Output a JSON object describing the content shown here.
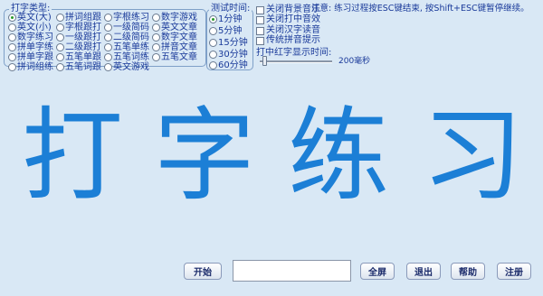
{
  "typing_type": {
    "title": "打字类型:",
    "options": [
      {
        "label": "英文(大)",
        "checked": true
      },
      {
        "label": "英文(小)",
        "checked": false
      },
      {
        "label": "数字练习",
        "checked": false
      },
      {
        "label": "拼单字练",
        "checked": false
      },
      {
        "label": "拼单字跟",
        "checked": false
      },
      {
        "label": "拼词组练",
        "checked": false
      },
      {
        "label": "拼词组跟",
        "checked": false
      },
      {
        "label": "字根跟打",
        "checked": false
      },
      {
        "label": "一级跟打",
        "checked": false
      },
      {
        "label": "二级跟打",
        "checked": false
      },
      {
        "label": "五笔单跟",
        "checked": false
      },
      {
        "label": "五笔词跟",
        "checked": false
      },
      {
        "label": "字根练习",
        "checked": false
      },
      {
        "label": "一级简码",
        "checked": false
      },
      {
        "label": "二级简码",
        "checked": false
      },
      {
        "label": "五笔单练",
        "checked": false
      },
      {
        "label": "五笔词练",
        "checked": false
      },
      {
        "label": "英文游戏",
        "checked": false
      },
      {
        "label": "数字游戏",
        "checked": false
      },
      {
        "label": "英文文章",
        "checked": false
      },
      {
        "label": "数字文章",
        "checked": false
      },
      {
        "label": "拼音文章",
        "checked": false
      },
      {
        "label": "五笔文章",
        "checked": false
      }
    ]
  },
  "test_time": {
    "title": "测试时间:",
    "options": [
      {
        "label": "1分钟",
        "checked": true
      },
      {
        "label": "5分钟",
        "checked": false
      },
      {
        "label": "15分钟",
        "checked": false
      },
      {
        "label": "30分钟",
        "checked": false
      },
      {
        "label": "60分钟",
        "checked": false
      }
    ]
  },
  "settings": [
    {
      "label": "关闭背景音乐"
    },
    {
      "label": "关闭打中音效"
    },
    {
      "label": "关闭汉字读音"
    },
    {
      "label": "传统拼音提示"
    }
  ],
  "note": "注意: 练习过程按ESC键结束, 按Shift+ESC键暂停继续。",
  "speed": {
    "label": "打中红字显示时间:",
    "value_text": "200毫秒"
  },
  "title_chars": [
    "打",
    "字",
    "练",
    "习"
  ],
  "input": {
    "value": ""
  },
  "buttons": {
    "start": "开始",
    "fullscreen": "全屏",
    "exit": "退出",
    "help": "帮助",
    "logout": "注册"
  }
}
